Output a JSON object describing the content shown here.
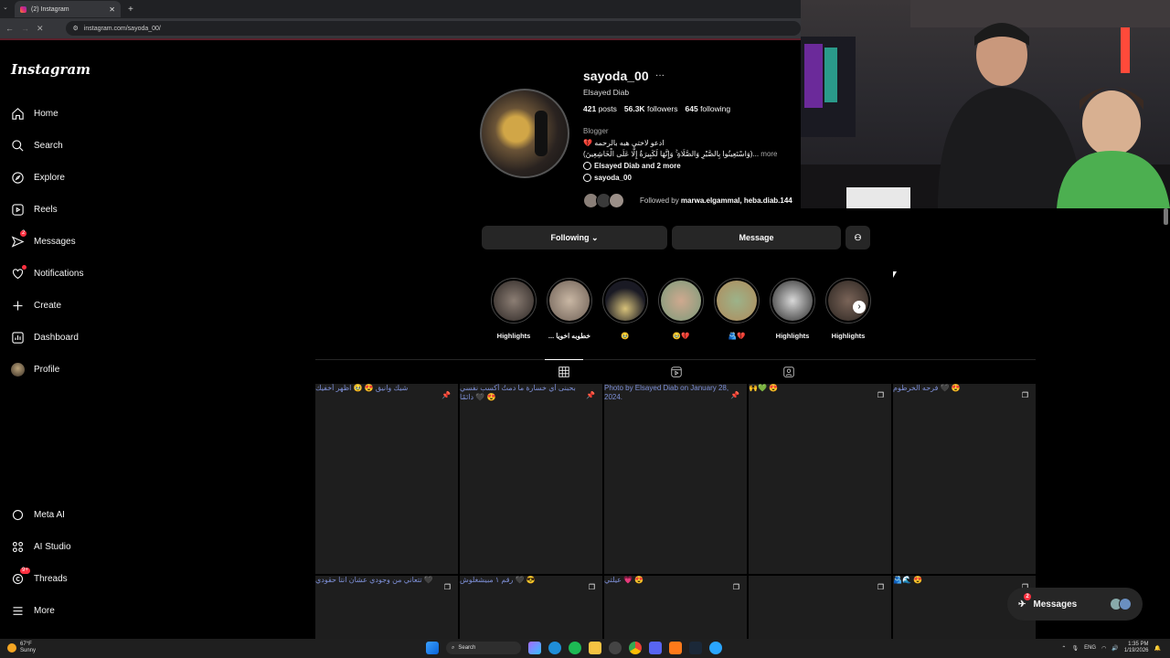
{
  "browser": {
    "tab_title": "(2) Instagram",
    "url": "instagram.com/sayoda_00/"
  },
  "sidebar": {
    "logo": "Instagram",
    "items": [
      {
        "label": "Home"
      },
      {
        "label": "Search"
      },
      {
        "label": "Explore"
      },
      {
        "label": "Reels"
      },
      {
        "label": "Messages",
        "badge": "2"
      },
      {
        "label": "Notifications"
      },
      {
        "label": "Create"
      },
      {
        "label": "Dashboard"
      },
      {
        "label": "Profile"
      }
    ],
    "bottom_items": [
      {
        "label": "Meta AI"
      },
      {
        "label": "AI Studio"
      },
      {
        "label": "Threads",
        "badge": "9+"
      },
      {
        "label": "More"
      }
    ]
  },
  "profile": {
    "username": "sayoda_00",
    "full_name": "Elsayed Diab",
    "posts_count": "421",
    "posts_label": "posts",
    "followers_count": "56.3K",
    "followers_label": "followers",
    "following_count": "645",
    "following_label": "following",
    "category": "Blogger",
    "bio_line1": "💔 ادعو لاختي هبه بالرحمه",
    "bio_line2": "(وَاسْتَعِينُوا بِالصَّبْرِ وَالصَّلَاةِ ۚ وَإِنَّهَا لَكَبِيرَةٌ إِلَّا عَلَى الْخَاشِعِينَ)...",
    "bio_more": "more",
    "links_text": "Elsayed Diab and 2 more",
    "threads_handle": "sayoda_00",
    "followed_by_prefix": "Followed by",
    "followed_by_names": "marwa.elgammal, heba.diab.144"
  },
  "actions": {
    "following": "Following",
    "message": "Message"
  },
  "highlights": [
    {
      "label": "Highlights"
    },
    {
      "label": "... خطوبه اخويا"
    },
    {
      "label": "🥹"
    },
    {
      "label": "🥹💔"
    },
    {
      "label": "🫂💔"
    },
    {
      "label": "Highlights"
    },
    {
      "label": "Highlights"
    }
  ],
  "posts": [
    {
      "caption": "شيك وانيق 😍 🥹 اظهر أخفيك"
    },
    {
      "caption": "بحبنى أي خسارة ما دمتُ أكسب نفسي دائمًا 🖤 😍"
    },
    {
      "caption": "Photo by Elsayed Diab on January 28, 2024."
    },
    {
      "caption": "🙌💚 😍"
    },
    {
      "caption": "فرحه الخرطوم 🖤 😍"
    },
    {
      "caption": "تتعاني من وجودي عشان انتا حقودي 🖤"
    },
    {
      "caption": "رقم ١ مبيشغلوش 🖤 😎"
    },
    {
      "caption": "عيلتي 💗 😍"
    },
    {
      "caption": ""
    },
    {
      "caption": "🫂🌊 😍"
    }
  ],
  "messages_pill": {
    "label": "Messages",
    "badge": "2"
  },
  "taskbar": {
    "temp": "67°F",
    "weather": "Sunny",
    "search": "Search",
    "lang": "ENG",
    "time": "1:35 PM",
    "date": "1/19/2026"
  }
}
